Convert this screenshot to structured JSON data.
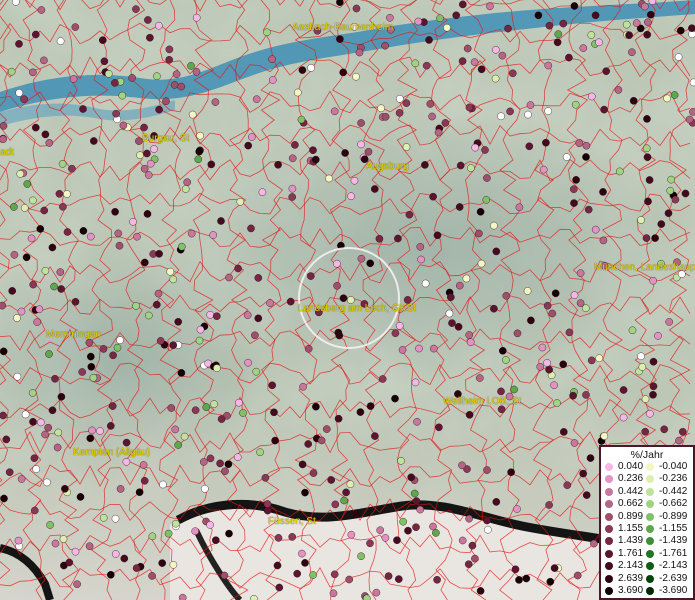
{
  "places": [
    {
      "name": "Aasbach-Baumenheim"
    },
    {
      "name": "Burgau, St"
    },
    {
      "name": "Augsburg"
    },
    {
      "name": "München, Landeshauptstadt"
    },
    {
      "name": "Landsberg am Lech, GKSt"
    },
    {
      "name": "Memmingen"
    },
    {
      "name": "Weilheim i.OB, St"
    },
    {
      "name": "Kempten (Allgäu)"
    },
    {
      "name": "Füssen, St"
    },
    {
      "name": "adt"
    }
  ],
  "legend": {
    "title": "%/Jahr",
    "positive": [
      "0.040",
      "0.236",
      "0.442",
      "0.662",
      "0.899",
      "1.155",
      "1.439",
      "1.761",
      "2.143",
      "2.639",
      "3.690"
    ],
    "negative": [
      "-0.040",
      "-0.236",
      "-0.442",
      "-0.662",
      "-0.899",
      "-1.155",
      "-1.439",
      "-1.761",
      "-2.143",
      "-2.639",
      "-3.690"
    ],
    "positive_colors": [
      "#f5b8e6",
      "#e293c3",
      "#c9779d",
      "#b36583",
      "#9e4f6a",
      "#893956",
      "#732743",
      "#5c1530",
      "#440b1f",
      "#2c0410",
      "#140005"
    ],
    "negative_colors": [
      "#f3f7c3",
      "#dbf0b0",
      "#bfe39a",
      "#a0d480",
      "#7fc167",
      "#5da84c",
      "#3d8f36",
      "#227623",
      "#105d14",
      "#054409",
      "#012b03"
    ]
  },
  "colors": {
    "sea": "#3f8fb5",
    "boundary": "#e01818",
    "highlight_circle": "#f2f2f2",
    "label_text": "#e6d200"
  }
}
